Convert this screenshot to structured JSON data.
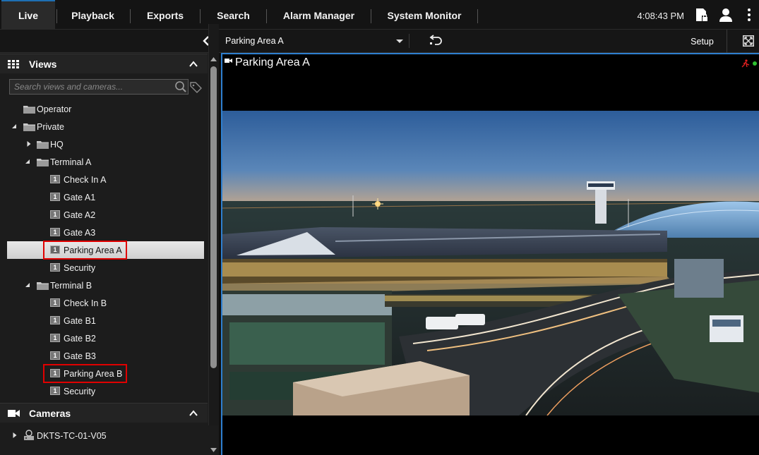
{
  "nav": {
    "tabs": [
      {
        "label": "Live",
        "active": true
      },
      {
        "label": "Playback"
      },
      {
        "label": "Exports"
      },
      {
        "label": "Search"
      },
      {
        "label": "Alarm Manager"
      },
      {
        "label": "System Monitor"
      }
    ],
    "clock": "4:08:43 PM",
    "icons": [
      "login-lock-icon",
      "user-icon",
      "more-vertical-icon"
    ]
  },
  "views_panel": {
    "title": "Views",
    "search_placeholder": "Search views and cameras...",
    "tree": [
      {
        "label": "Operator",
        "type": "folder",
        "level": 0
      },
      {
        "label": "Private",
        "type": "folder",
        "level": 0,
        "expanded": true
      },
      {
        "label": "HQ",
        "type": "folder",
        "level": 1,
        "expanded": false
      },
      {
        "label": "Terminal A",
        "type": "folder",
        "level": 1,
        "expanded": true
      },
      {
        "label": "Check In A",
        "type": "view",
        "level": 2,
        "badge": "1"
      },
      {
        "label": "Gate A1",
        "type": "view",
        "level": 2,
        "badge": "1"
      },
      {
        "label": "Gate A2",
        "type": "view",
        "level": 2,
        "badge": "1"
      },
      {
        "label": "Gate A3",
        "type": "view",
        "level": 2,
        "badge": "1"
      },
      {
        "label": "Parking Area A",
        "type": "view",
        "level": 2,
        "badge": "1",
        "selected": true,
        "highlighted": true
      },
      {
        "label": "Security",
        "type": "view",
        "level": 2,
        "badge": "1"
      },
      {
        "label": "Terminal B",
        "type": "folder",
        "level": 1,
        "expanded": true
      },
      {
        "label": "Check In B",
        "type": "view",
        "level": 2,
        "badge": "1"
      },
      {
        "label": "Gate B1",
        "type": "view",
        "level": 2,
        "badge": "1"
      },
      {
        "label": "Gate B2",
        "type": "view",
        "level": 2,
        "badge": "1"
      },
      {
        "label": "Gate B3",
        "type": "view",
        "level": 2,
        "badge": "1"
      },
      {
        "label": "Parking Area B",
        "type": "view",
        "level": 2,
        "badge": "1",
        "highlighted": true
      },
      {
        "label": "Security",
        "type": "view",
        "level": 2,
        "badge": "1"
      }
    ]
  },
  "cameras_panel": {
    "title": "Cameras",
    "items": [
      {
        "label": "DKTS-TC-01-V05",
        "type": "server",
        "expanded": false
      }
    ]
  },
  "view_toolbar": {
    "selected_view": "Parking Area A",
    "setup_label": "Setup"
  },
  "camera_tile": {
    "title": "Parking Area A"
  },
  "colors": {
    "accent": "#2e7fcf",
    "highlight": "#e00000",
    "status_green": "#2fbf2f",
    "status_red": "#e02020"
  }
}
